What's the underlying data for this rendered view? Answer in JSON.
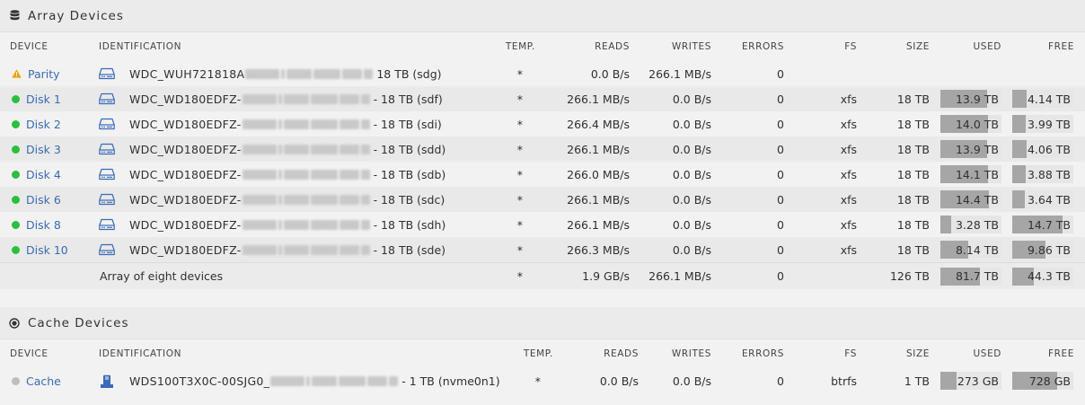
{
  "array": {
    "title": "Array Devices",
    "headers": {
      "device": "DEVICE",
      "identification": "IDENTIFICATION",
      "temp": "TEMP.",
      "reads": "READS",
      "writes": "WRITES",
      "errors": "ERRORS",
      "fs": "FS",
      "size": "SIZE",
      "used": "USED",
      "free": "FREE"
    },
    "rows": [
      {
        "status": "warning",
        "name": "Parity",
        "id_prefix": "WDC_WUH721818A",
        "id_suffix": "18 TB (sdg)",
        "temp": "*",
        "reads": "0.0 B/s",
        "writes": "266.1 MB/s",
        "errors": "0",
        "fs": "",
        "size": "",
        "used": "",
        "free": "",
        "used_frac": null,
        "free_frac": null
      },
      {
        "status": "ok",
        "name": "Disk 1",
        "id_prefix": "WDC_WD180EDFZ-",
        "id_suffix": "- 18 TB (sdf)",
        "temp": "*",
        "reads": "266.1 MB/s",
        "writes": "0.0 B/s",
        "errors": "0",
        "fs": "xfs",
        "size": "18 TB",
        "used": "13.9 TB",
        "free": "4.14 TB",
        "used_frac": 0.77,
        "free_frac": 0.23
      },
      {
        "status": "ok",
        "name": "Disk 2",
        "id_prefix": "WDC_WD180EDFZ-",
        "id_suffix": "- 18 TB (sdi)",
        "temp": "*",
        "reads": "266.4 MB/s",
        "writes": "0.0 B/s",
        "errors": "0",
        "fs": "xfs",
        "size": "18 TB",
        "used": "14.0 TB",
        "free": "3.99 TB",
        "used_frac": 0.78,
        "free_frac": 0.22
      },
      {
        "status": "ok",
        "name": "Disk 3",
        "id_prefix": "WDC_WD180EDFZ-",
        "id_suffix": "- 18 TB (sdd)",
        "temp": "*",
        "reads": "266.1 MB/s",
        "writes": "0.0 B/s",
        "errors": "0",
        "fs": "xfs",
        "size": "18 TB",
        "used": "13.9 TB",
        "free": "4.06 TB",
        "used_frac": 0.77,
        "free_frac": 0.23
      },
      {
        "status": "ok",
        "name": "Disk 4",
        "id_prefix": "WDC_WD180EDFZ-",
        "id_suffix": "- 18 TB (sdb)",
        "temp": "*",
        "reads": "266.0 MB/s",
        "writes": "0.0 B/s",
        "errors": "0",
        "fs": "xfs",
        "size": "18 TB",
        "used": "14.1 TB",
        "free": "3.88 TB",
        "used_frac": 0.78,
        "free_frac": 0.22
      },
      {
        "status": "ok",
        "name": "Disk 6",
        "id_prefix": "WDC_WD180EDFZ-",
        "id_suffix": "- 18 TB (sdc)",
        "temp": "*",
        "reads": "266.1 MB/s",
        "writes": "0.0 B/s",
        "errors": "0",
        "fs": "xfs",
        "size": "18 TB",
        "used": "14.4 TB",
        "free": "3.64 TB",
        "used_frac": 0.8,
        "free_frac": 0.2
      },
      {
        "status": "ok",
        "name": "Disk 8",
        "id_prefix": "WDC_WD180EDFZ-",
        "id_suffix": "- 18 TB (sdh)",
        "temp": "*",
        "reads": "266.1 MB/s",
        "writes": "0.0 B/s",
        "errors": "0",
        "fs": "xfs",
        "size": "18 TB",
        "used": "3.28 TB",
        "free": "14.7 TB",
        "used_frac": 0.18,
        "free_frac": 0.82
      },
      {
        "status": "ok",
        "name": "Disk 10",
        "id_prefix": "WDC_WD180EDFZ-",
        "id_suffix": "- 18 TB (sde)",
        "temp": "*",
        "reads": "266.3 MB/s",
        "writes": "0.0 B/s",
        "errors": "0",
        "fs": "xfs",
        "size": "18 TB",
        "used": "8.14 TB",
        "free": "9.86 TB",
        "used_frac": 0.45,
        "free_frac": 0.55
      }
    ],
    "total": {
      "label": "Array of eight devices",
      "temp": "*",
      "reads": "1.9 GB/s",
      "writes": "266.1 MB/s",
      "errors": "0",
      "size": "126 TB",
      "used": "81.7 TB",
      "free": "44.3 TB",
      "used_frac": 0.65,
      "free_frac": 0.35
    }
  },
  "cache": {
    "title": "Cache Devices",
    "headers": {
      "device": "DEVICE",
      "identification": "IDENTIFICATION",
      "temp": "TEMP.",
      "reads": "READS",
      "writes": "WRITES",
      "errors": "ERRORS",
      "fs": "FS",
      "size": "SIZE",
      "used": "USED",
      "free": "FREE"
    },
    "rows": [
      {
        "status": "standby",
        "name": "Cache",
        "id_prefix": "WDS100T3X0C-00SJG0_",
        "id_suffix": "- 1 TB (nvme0n1)",
        "temp": "*",
        "reads": "0.0 B/s",
        "writes": "0.0 B/s",
        "errors": "0",
        "fs": "btrfs",
        "size": "1 TB",
        "used": "273 GB",
        "free": "728 GB",
        "used_frac": 0.27,
        "free_frac": 0.73
      }
    ]
  },
  "colors": {
    "accent": "#3a6bb5",
    "ok": "#2bbf3f",
    "warning": "#f0a30a",
    "standby": "#bdbdbd"
  },
  "icons": {
    "array": "database-icon",
    "cache": "radio-target-icon",
    "disk": "hard-drive-icon",
    "nvme": "nvme-drive-icon"
  }
}
